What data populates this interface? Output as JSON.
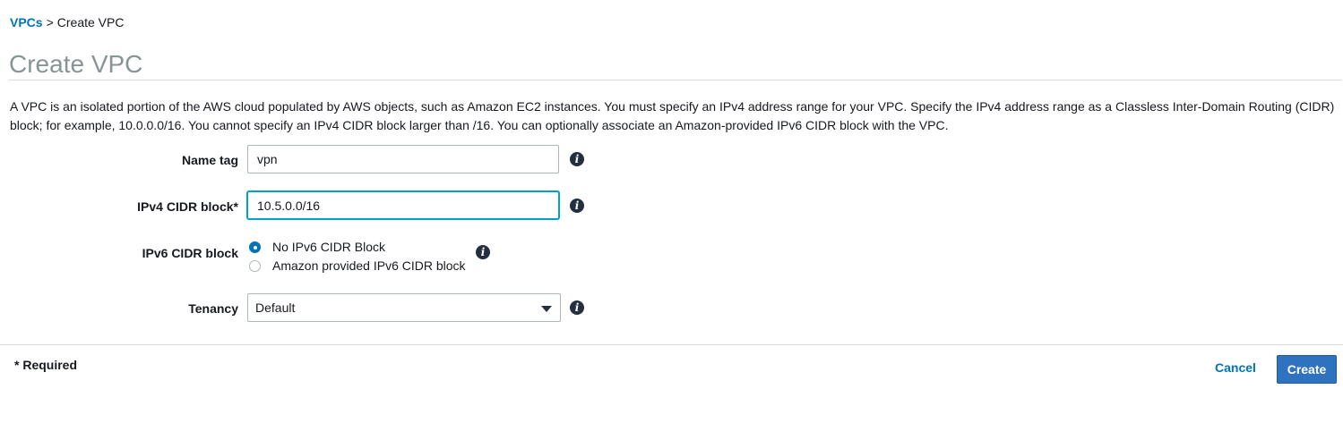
{
  "breadcrumb": {
    "link": "VPCs",
    "separator": ">",
    "current": "Create VPC"
  },
  "page": {
    "title": "Create VPC",
    "description": "A VPC is an isolated portion of the AWS cloud populated by AWS objects, such as Amazon EC2 instances. You must specify an IPv4 address range for your VPC. Specify the IPv4 address range as a Classless Inter-Domain Routing (CIDR) block; for example, 10.0.0.0/16. You cannot specify an IPv4 CIDR block larger than /16. You can optionally associate an Amazon-provided IPv6 CIDR block with the VPC."
  },
  "form": {
    "name_tag": {
      "label": "Name tag",
      "value": "vpn"
    },
    "ipv4": {
      "label": "IPv4 CIDR block*",
      "value": "10.5.0.0/16"
    },
    "ipv6": {
      "label": "IPv6 CIDR block",
      "options": [
        {
          "label": "No IPv6 CIDR Block",
          "checked": true
        },
        {
          "label": "Amazon provided IPv6 CIDR block",
          "checked": false
        }
      ]
    },
    "tenancy": {
      "label": "Tenancy",
      "value": "Default"
    },
    "info_glyph": "i"
  },
  "footer": {
    "required_note": "* Required",
    "cancel_label": "Cancel",
    "create_label": "Create"
  },
  "colors": {
    "link": "#0073bb",
    "primary_button": "#2f73c0",
    "focus": "#00a1c9",
    "title": "#879596"
  }
}
